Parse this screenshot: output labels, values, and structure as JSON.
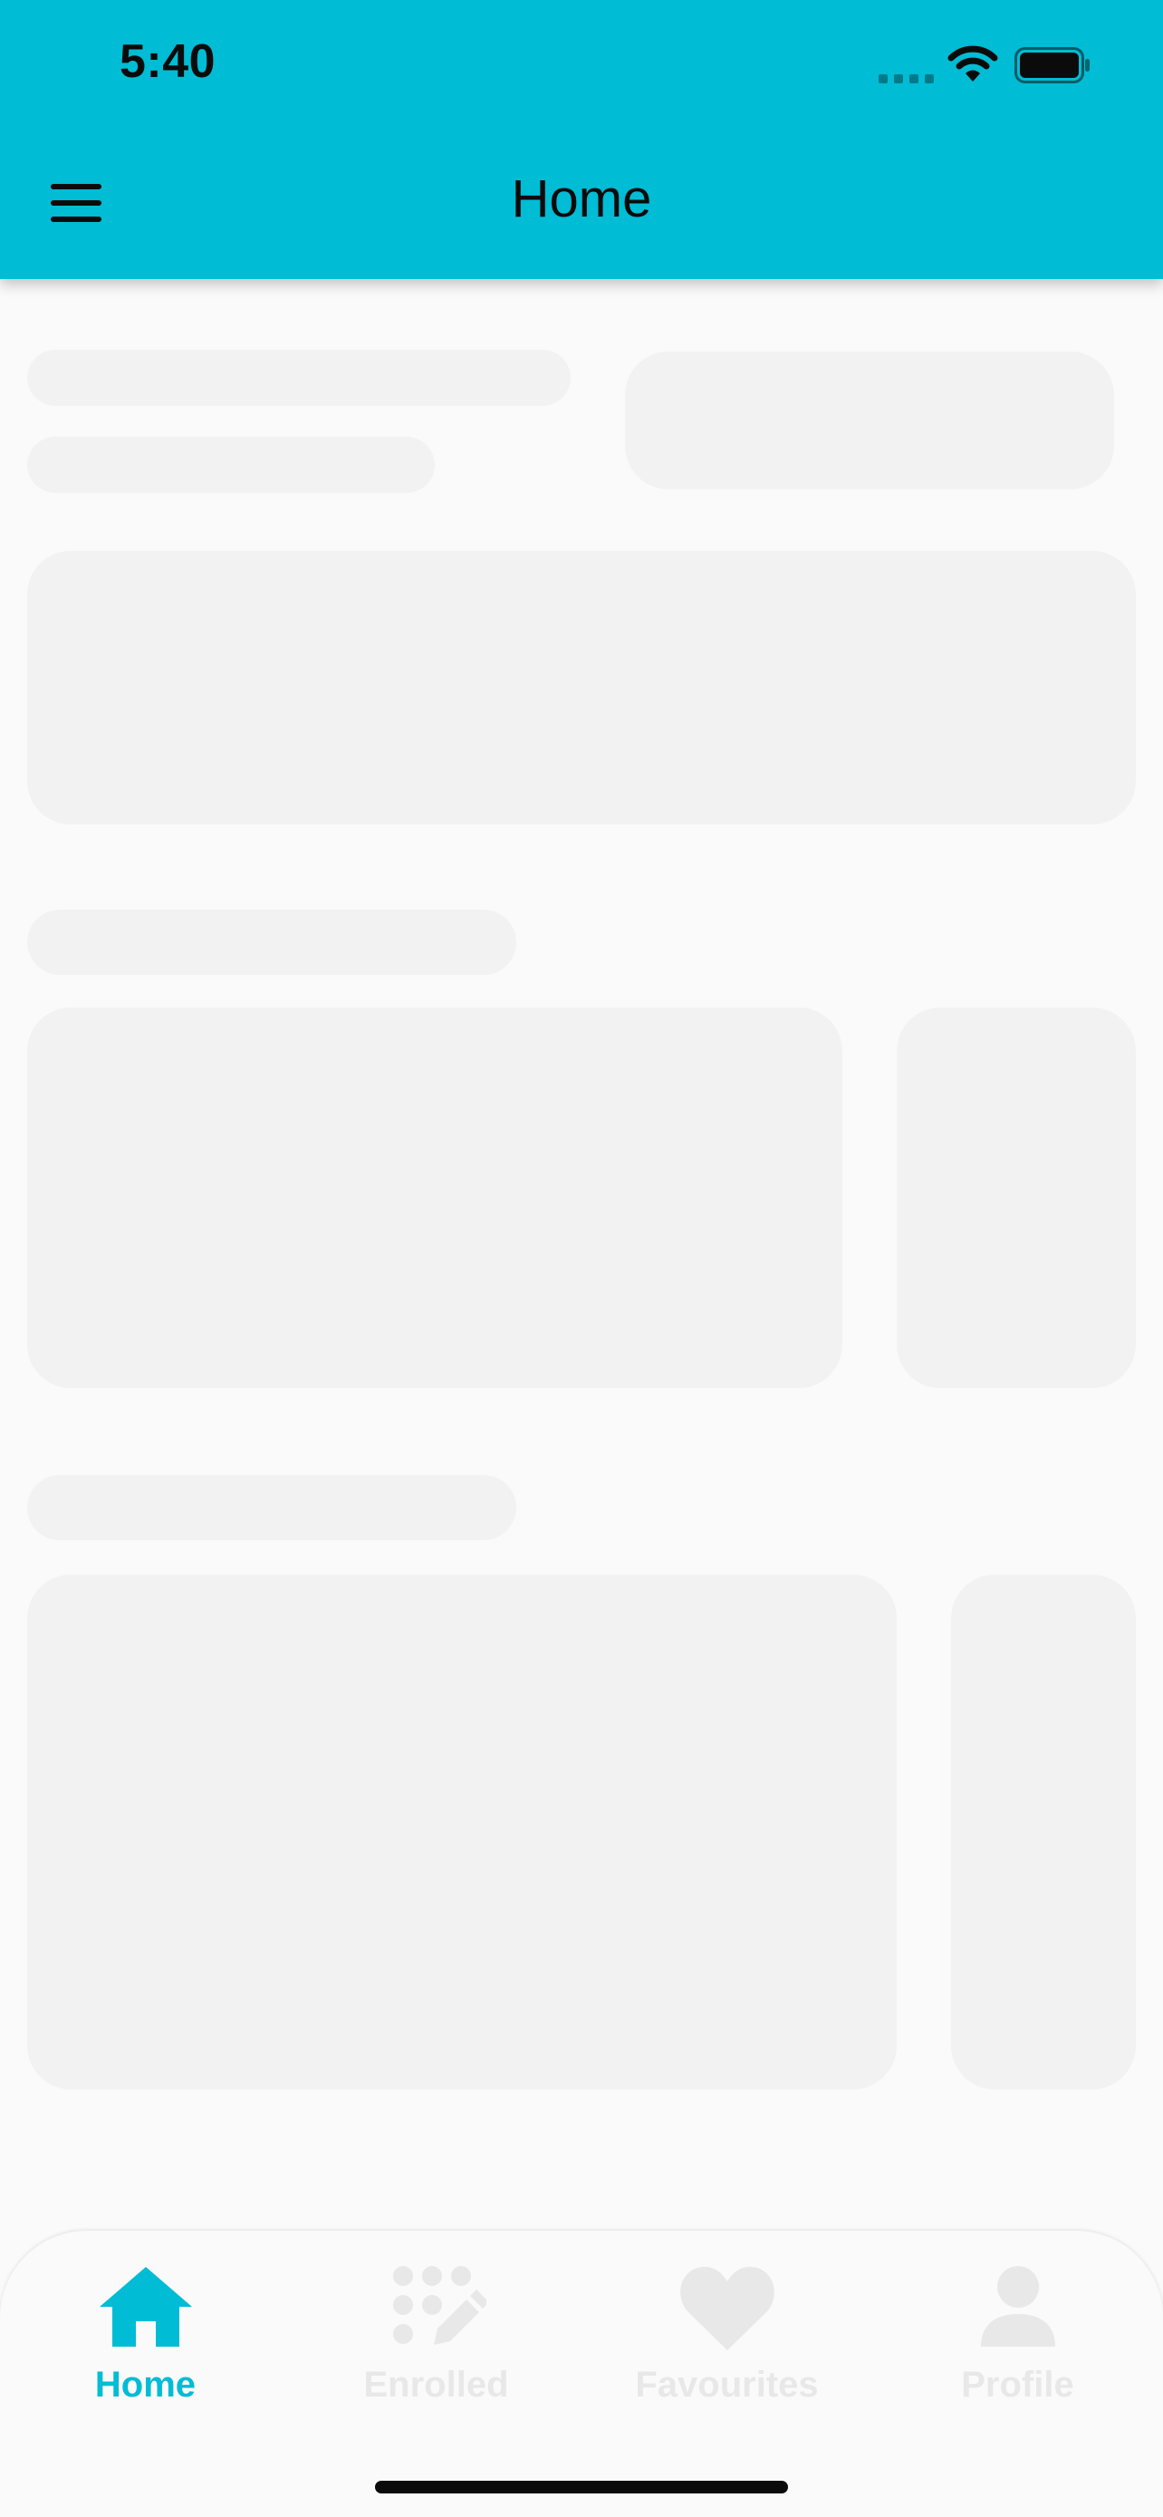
{
  "status_bar": {
    "time": "5:40"
  },
  "header": {
    "title": "Home",
    "menu_icon": "hamburger-menu-icon"
  },
  "colors": {
    "accent": "#00bcd4",
    "nav_inactive": "#e8e8e8",
    "skeleton": "#f2f2f2",
    "background": "#fafafa"
  },
  "bottom_nav": {
    "items": [
      {
        "label": "Home",
        "icon": "home-icon",
        "active": true
      },
      {
        "label": "Enrolled",
        "icon": "enrolled-icon",
        "active": false
      },
      {
        "label": "Favourites",
        "icon": "heart-icon",
        "active": false
      },
      {
        "label": "Profile",
        "icon": "profile-icon",
        "active": false
      }
    ]
  }
}
